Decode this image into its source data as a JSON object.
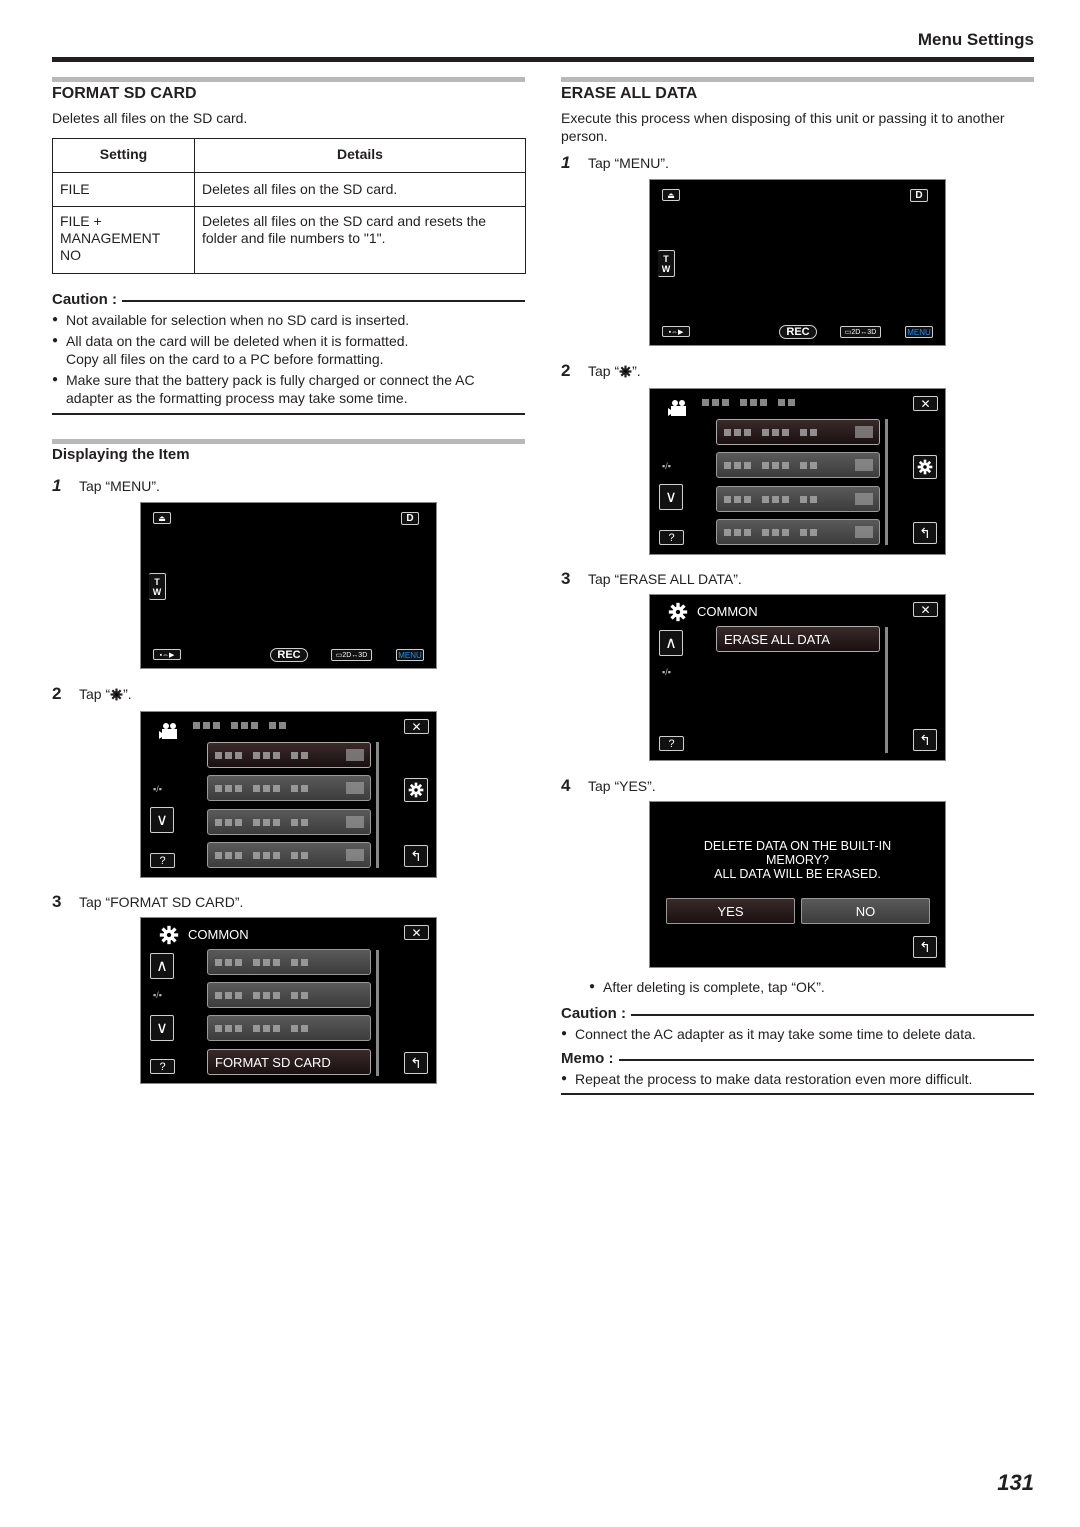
{
  "header": {
    "title": "Menu Settings"
  },
  "format_sd": {
    "title": "FORMAT SD CARD",
    "description": "Deletes all files on the SD card.",
    "table": {
      "headers": [
        "Setting",
        "Details"
      ],
      "rows": [
        {
          "setting": "FILE",
          "details": "Deletes all files on the SD card."
        },
        {
          "setting_lines": [
            "FILE +",
            "MANAGEMENT",
            "NO"
          ],
          "details": "Deletes all files on the SD card and resets the folder and file numbers to \"1\"."
        }
      ]
    },
    "caution": {
      "label": "Caution :",
      "items": [
        "Not available for selection when no SD card is inserted.",
        "All data on the card will be deleted when it is formatted.",
        "Copy all files on the card to a PC before formatting.",
        "Make sure that the battery pack is fully charged or connect the AC adapter as the formatting process may take some time."
      ]
    }
  },
  "displaying": {
    "title": "Displaying the Item",
    "steps": [
      {
        "num": "1",
        "text": "Tap “MENU”."
      },
      {
        "num": "2",
        "text_before": "Tap “",
        "text_after": "”."
      },
      {
        "num": "3",
        "text": "Tap “FORMAT SD CARD”."
      }
    ]
  },
  "erase_all": {
    "title": "ERASE ALL DATA",
    "description": "Execute this process when disposing of this unit or passing it to another person.",
    "steps": [
      {
        "num": "1",
        "text": "Tap “MENU”."
      },
      {
        "num": "2",
        "text_before": "Tap “",
        "text_after": "”."
      },
      {
        "num": "3",
        "text": "Tap “ERASE ALL DATA”."
      },
      {
        "num": "4",
        "text": "Tap “YES”."
      }
    ],
    "after_note": "After deleting is complete, tap “OK”.",
    "caution": {
      "label": "Caution :",
      "items": [
        "Connect the AC adapter as it may take some time to delete data."
      ]
    },
    "memo": {
      "label": "Memo :",
      "items": [
        "Repeat the process to make data restoration even more difficult."
      ]
    }
  },
  "screens": {
    "live": {
      "tw_top": "T",
      "tw_bottom": "W",
      "d_label": "D",
      "rec": "REC",
      "mode_2d3d": "▭2D↔3D",
      "menu": "MENU",
      "menu_color": "#1e90ff"
    },
    "menu": {
      "page": "▪/▪",
      "help": "?"
    },
    "common": {
      "title": "COMMON",
      "format_item": "FORMAT SD CARD",
      "erase_item": "ERASE ALL DATA",
      "page": "▪/▪",
      "help": "?"
    },
    "confirm": {
      "message_lines": [
        "DELETE DATA ON THE BUILT-IN",
        "MEMORY?",
        "ALL DATA WILL BE ERASED."
      ],
      "yes": "YES",
      "no": "NO"
    }
  },
  "page_number": "131"
}
